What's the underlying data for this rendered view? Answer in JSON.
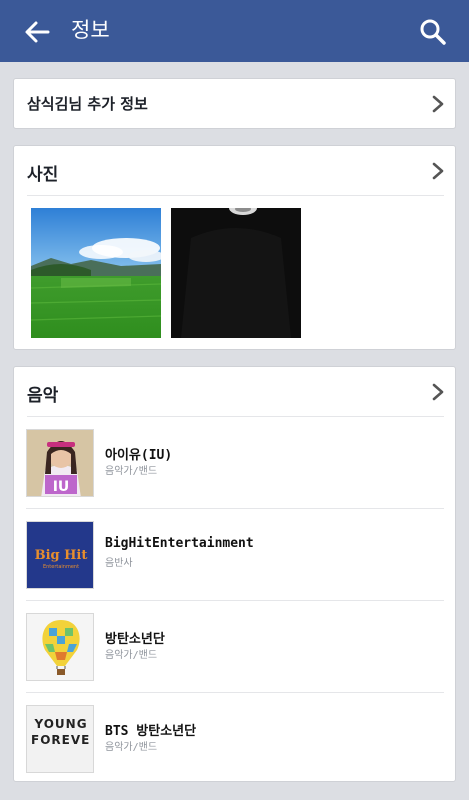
{
  "header": {
    "title": "정보",
    "back_icon": "arrow-left-icon",
    "search_icon": "search-icon",
    "color": "#3b5998"
  },
  "extra_info": {
    "label": "삼식김님 추가 정보"
  },
  "photos": {
    "title": "사진",
    "items": [
      {
        "name": "landscape-photo"
      },
      {
        "name": "dark-photo"
      }
    ]
  },
  "music": {
    "title": "음악",
    "items": [
      {
        "name": "아이유(IU)",
        "category": "음악가/밴드",
        "thumb_text": "IU"
      },
      {
        "name": "BigHitEntertainment",
        "category": "음반사",
        "thumb_text": "Big Hit",
        "thumb_subtext": "Entertainment"
      },
      {
        "name": "방탄소년단",
        "category": "음악가/밴드"
      },
      {
        "name": "BTS 방탄소년단",
        "category": "음악가/밴드",
        "thumb_text": "YOUNG FOREVER"
      }
    ]
  }
}
